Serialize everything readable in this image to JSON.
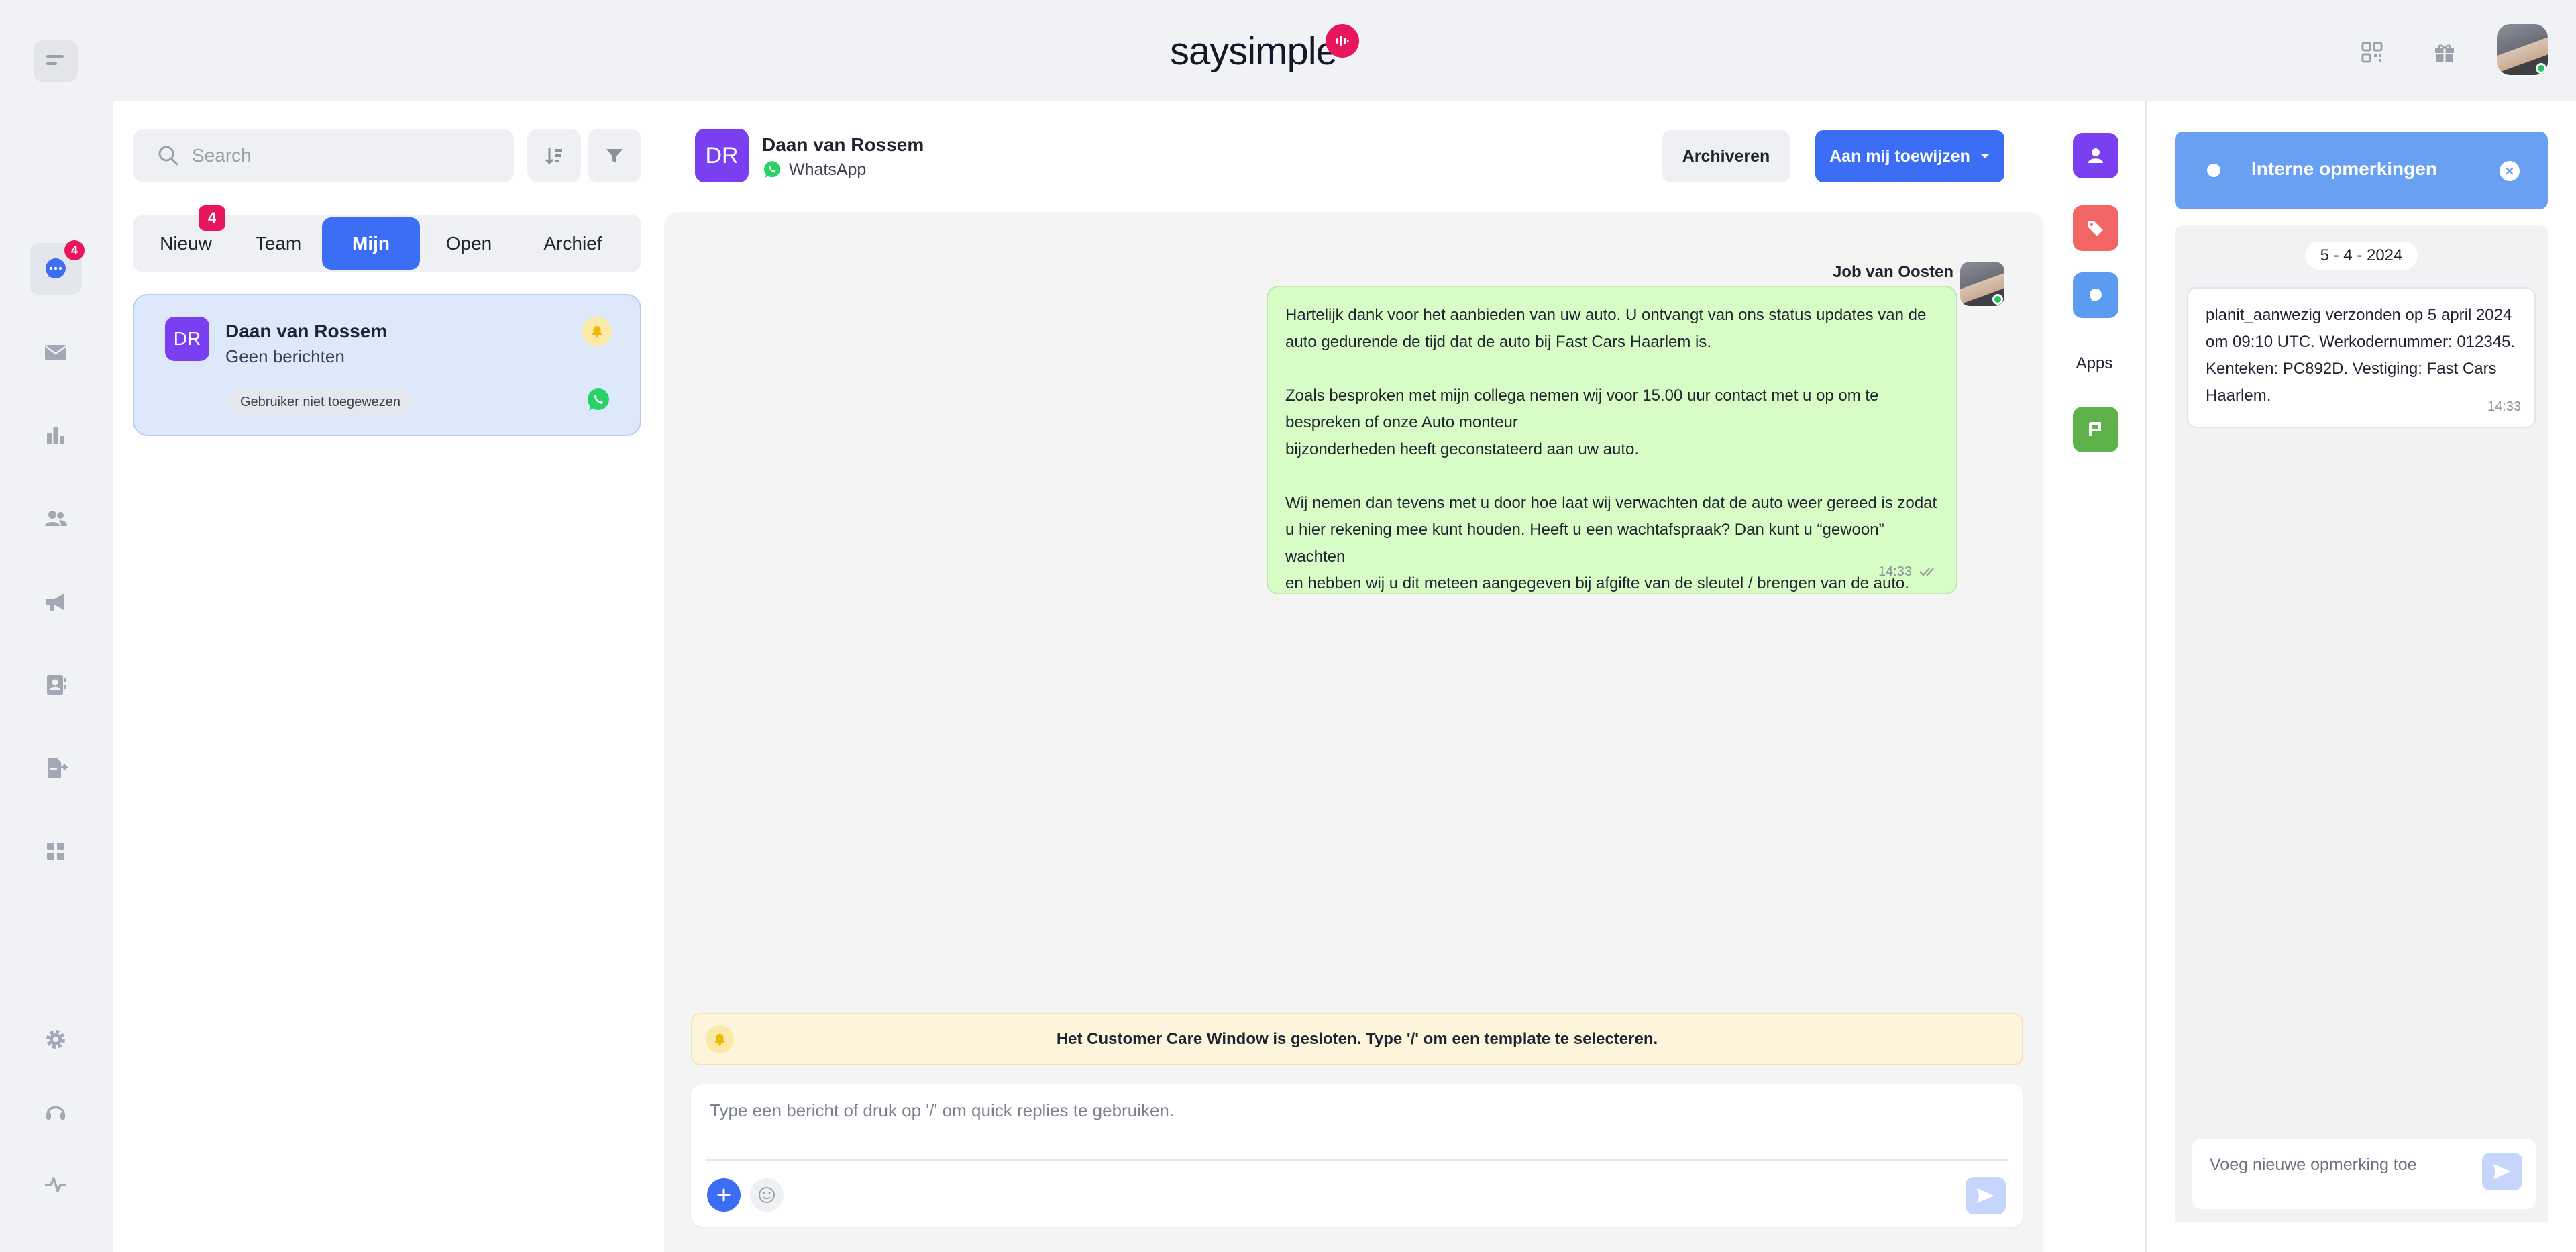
{
  "brand": {
    "logo_text": "saysimple",
    "accent": "#3b6df5",
    "brand_pink": "#e8175d"
  },
  "rail": {
    "items": [
      {
        "name": "conversations",
        "icon": "chat-bubble-icon",
        "badge": "4",
        "active": true
      },
      {
        "name": "email",
        "icon": "envelope-icon"
      },
      {
        "name": "reports",
        "icon": "bar-chart-icon"
      },
      {
        "name": "contacts",
        "icon": "users-icon"
      },
      {
        "name": "campaigns",
        "icon": "megaphone-icon"
      },
      {
        "name": "address-book",
        "icon": "contact-card-icon"
      },
      {
        "name": "export",
        "icon": "file-export-icon"
      },
      {
        "name": "apps",
        "icon": "grid-icon"
      },
      {
        "name": "settings",
        "icon": "gear-icon"
      },
      {
        "name": "support",
        "icon": "headset-icon"
      },
      {
        "name": "status",
        "icon": "pulse-icon"
      }
    ]
  },
  "topbar": {
    "icons": [
      "qr-code-icon",
      "gift-icon",
      "user-avatar"
    ]
  },
  "conversation_list": {
    "search_placeholder": "Search",
    "tabs": [
      {
        "label": "Nieuw",
        "badge": "4",
        "active": false
      },
      {
        "label": "Team",
        "active": false
      },
      {
        "label": "Mijn",
        "active": true
      },
      {
        "label": "Open",
        "active": false
      },
      {
        "label": "Archief",
        "active": false
      }
    ],
    "items": [
      {
        "initials": "DR",
        "name": "Daan van Rossem",
        "preview": "Geen berichten",
        "assignment": "Gebruiker niet toegewezen",
        "channel_icon": "whatsapp-icon"
      }
    ]
  },
  "chat": {
    "contact_initials": "DR",
    "contact_name": "Daan van Rossem",
    "channel": "WhatsApp",
    "archive_label": "Archiveren",
    "assign_label": "Aan mij toewijzen",
    "sender_name": "Job van Oosten",
    "message_lines": [
      "Hartelijk dank voor het aanbieden van uw auto. U ontvangt van ons status updates van de",
      "auto gedurende de tijd dat de auto bij Fast Cars Haarlem is.",
      "",
      "Zoals besproken met mijn collega nemen wij voor 15.00 uur contact met u op om te",
      "bespreken of onze Auto monteur",
      "bijzonderheden heeft geconstateerd aan uw auto.",
      "",
      "Wij nemen dan tevens met u door hoe laat wij verwachten dat de auto weer gereed is zodat",
      "u hier rekening mee kunt houden. Heeft u een wachtafspraak? Dan kunt u “gewoon” wachten",
      "en hebben wij u dit meteen aangegeven bij afgifte van de sleutel / brengen van de auto."
    ],
    "message_time": "14:33",
    "notice": "Het Customer Care Window is gesloten. Type '/' om een template te selecteren.",
    "composer_placeholder": "Type een bericht of druk op '/' om quick replies te gebruiken."
  },
  "app_strip": {
    "buttons": [
      {
        "name": "contact",
        "icon": "person-icon",
        "color": "#7b3ff2"
      },
      {
        "name": "labels",
        "icon": "tag-icon",
        "color": "#f26565"
      },
      {
        "name": "notes",
        "icon": "comment-icon",
        "color": "#5b9cf2"
      },
      {
        "name": "planit",
        "icon": "planit-icon",
        "color": "#5fb24a"
      }
    ],
    "apps_label": "Apps"
  },
  "notes": {
    "title": "Interne opmerkingen",
    "date": "5 - 4 - 2024",
    "note_lines": [
      "planit_aanwezig verzonden op 5 april 2024",
      "om 09:10 UTC. Werkodernummer: 012345.",
      "Kenteken: PC892D. Vestiging: Fast Cars",
      "Haarlem."
    ],
    "note_time": "14:33",
    "input_placeholder": "Voeg nieuwe opmerking toe"
  }
}
